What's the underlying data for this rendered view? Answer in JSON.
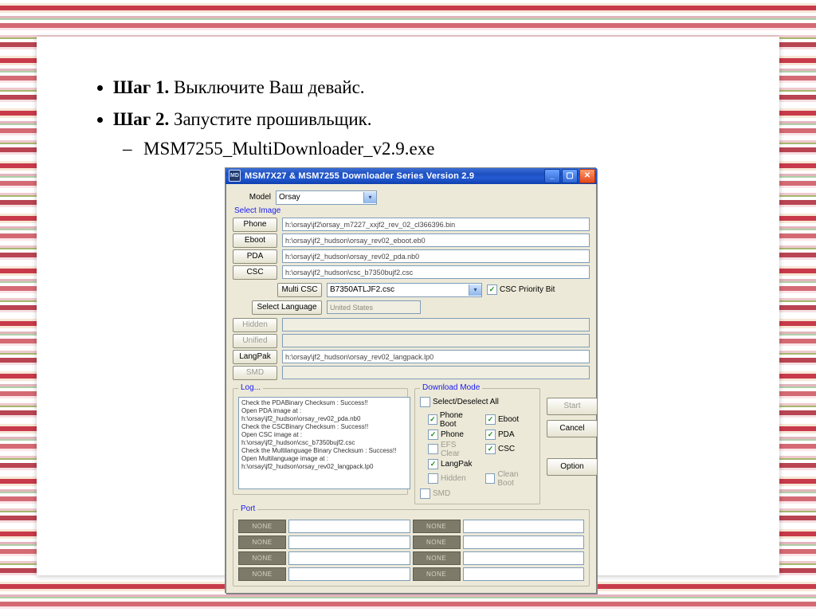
{
  "steps": {
    "item1": {
      "bold": "Шаг 1.",
      "text": " Выключите Ваш девайс."
    },
    "item2": {
      "bold": "Шаг 2.",
      "text": "  Запустите прошивльщик.",
      "sub": "MSM7255_MultiDownloader_v2.9.exe"
    }
  },
  "app": {
    "icon_text": "MD",
    "title": "MSM7X27 & MSM7255 Downloader Series Version 2.9",
    "model_label": "Model",
    "model_value": "Orsay",
    "select_image_label": "Select Image",
    "rows": {
      "phone": {
        "btn": "Phone",
        "path": "h:\\orsay\\jf2\\orsay_m7227_xxjf2_rev_02_cl366396.bin"
      },
      "eboot": {
        "btn": "Eboot",
        "path": "h:\\orsay\\jf2_hudson\\orsay_rev02_eboot.eb0"
      },
      "pda": {
        "btn": "PDA",
        "path": "h:\\orsay\\jf2_hudson\\orsay_rev02_pda.nb0"
      },
      "csc": {
        "btn": "CSC",
        "path": "h:\\orsay\\jf2_hudson\\csc_b7350bujf2.csc"
      },
      "hidden": {
        "btn": "Hidden",
        "path": ""
      },
      "unified": {
        "btn": "Unified",
        "path": ""
      },
      "langpak": {
        "btn": "LangPak",
        "path": "h:\\orsay\\jf2_hudson\\orsay_rev02_langpack.lp0"
      },
      "smd": {
        "btn": "SMD",
        "path": ""
      }
    },
    "multi_csc_label": "Multi CSC",
    "multi_csc_value": "B7350ATLJF2.csc",
    "csc_priority_label": "CSC Priority Bit",
    "select_language_btn": "Select Language",
    "select_language_value": "United States",
    "log": {
      "legend": "Log...",
      "text": "Check the PDABinary Checksum : Success!!\nOpen PDA image at :\nh:\\orsay\\jf2_hudson\\orsay_rev02_pda.nb0\nCheck the CSCBinary Checksum : Success!!\nOpen CSC image at :\nh:\\orsay\\jf2_hudson\\csc_b7350bujf2.csc\nCheck the Multilanguage Binary Checksum : Success!!\nOpen Multilanguage image at :\nh:\\orsay\\jf2_hudson\\orsay_rev02_langpack.lp0"
    },
    "download_mode": {
      "legend": "Download Mode",
      "select_all": "Select/Deselect All",
      "phone_boot": "Phone Boot",
      "eboot": "Eboot",
      "phone": "Phone",
      "pda": "PDA",
      "efs_clear": "EFS Clear",
      "csc": "CSC",
      "langpak": "LangPak",
      "hidden": "Hidden",
      "clean_boot": "Clean Boot",
      "smd": "SMD"
    },
    "buttons": {
      "start": "Start",
      "cancel": "Cancel",
      "option": "Option"
    },
    "port": {
      "legend": "Port",
      "none": "NONE"
    }
  }
}
